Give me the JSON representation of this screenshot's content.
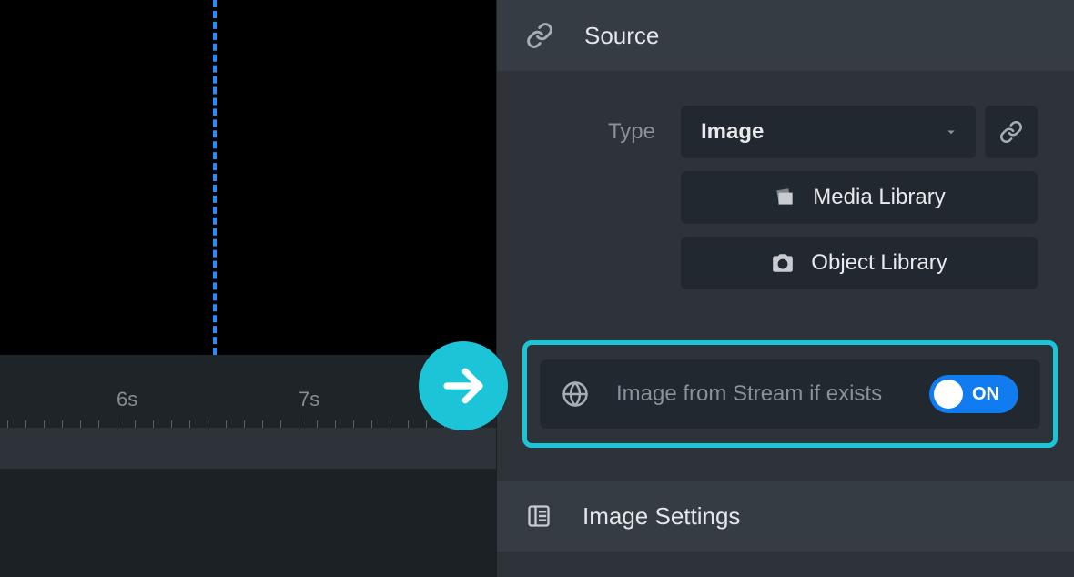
{
  "timeline": {
    "labels": [
      "6s",
      "7s"
    ]
  },
  "source": {
    "header": "Source",
    "type_label": "Type",
    "type_value": "Image",
    "media_library": "Media Library",
    "object_library": "Object Library",
    "stream_label": "Image from Stream if exists",
    "toggle_state": "ON"
  },
  "image_settings": {
    "header": "Image Settings"
  }
}
